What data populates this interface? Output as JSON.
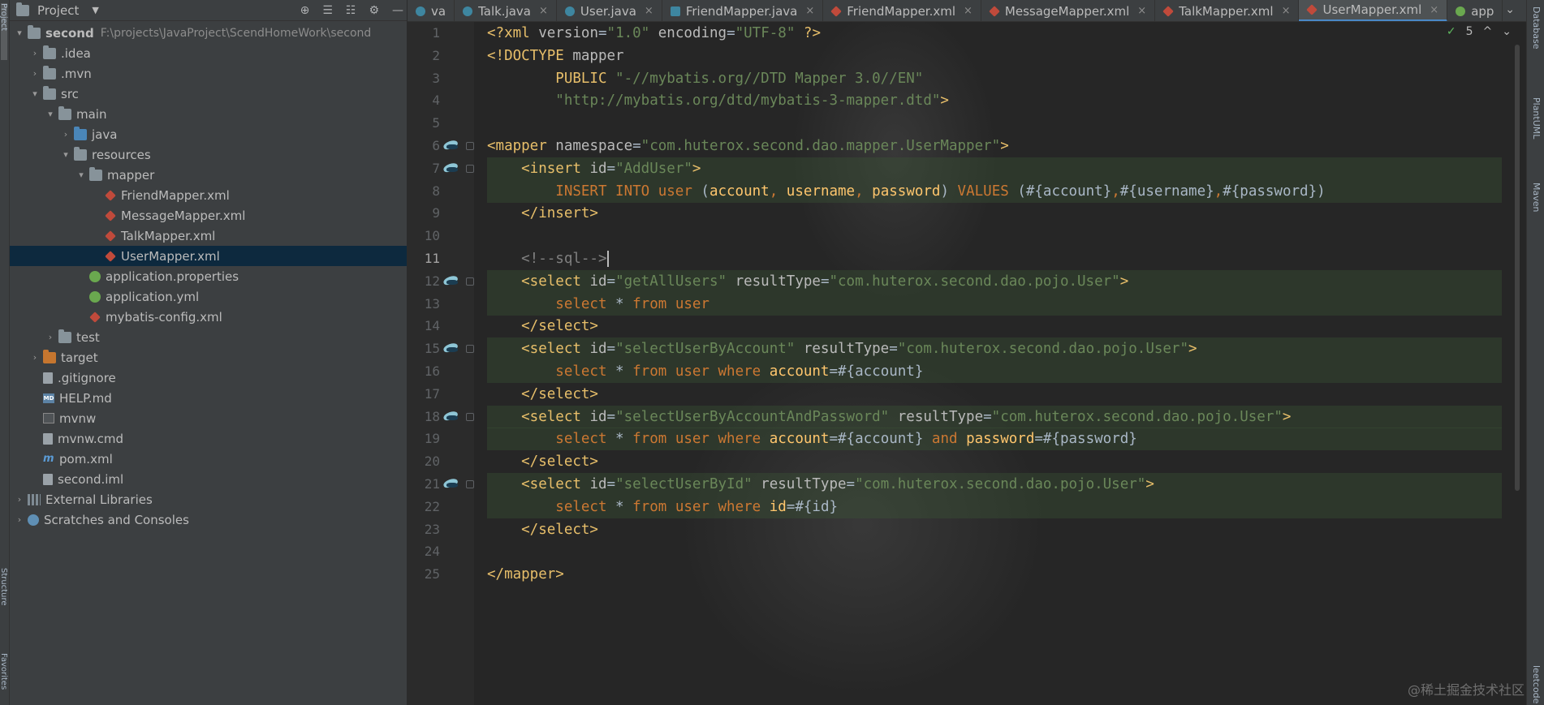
{
  "left_strip": {
    "top_label": "Project",
    "bottom_label": "Structure",
    "fav_label": "Favorites"
  },
  "project_panel": {
    "title": "Project",
    "caret": "▼",
    "tools": [
      "⊕",
      "☰",
      "☷",
      "⚙",
      "—"
    ]
  },
  "tree": [
    {
      "label": "second",
      "path": "F:\\projects\\JavaProject\\ScendHomeWork\\second",
      "indent": 0,
      "arrow": "▾",
      "icon": "folder",
      "bold": true
    },
    {
      "label": ".idea",
      "indent": 1,
      "arrow": "›",
      "icon": "folder"
    },
    {
      "label": ".mvn",
      "indent": 1,
      "arrow": "›",
      "icon": "folder"
    },
    {
      "label": "src",
      "indent": 1,
      "arrow": "▾",
      "icon": "folder"
    },
    {
      "label": "main",
      "indent": 2,
      "arrow": "▾",
      "icon": "folder"
    },
    {
      "label": "java",
      "indent": 3,
      "arrow": "›",
      "icon": "folder-blue"
    },
    {
      "label": "resources",
      "indent": 3,
      "arrow": "▾",
      "icon": "folder-res"
    },
    {
      "label": "mapper",
      "indent": 4,
      "arrow": "▾",
      "icon": "folder"
    },
    {
      "label": "FriendMapper.xml",
      "indent": 5,
      "arrow": "",
      "icon": "xml"
    },
    {
      "label": "MessageMapper.xml",
      "indent": 5,
      "arrow": "",
      "icon": "xml"
    },
    {
      "label": "TalkMapper.xml",
      "indent": 5,
      "arrow": "",
      "icon": "xml"
    },
    {
      "label": "UserMapper.xml",
      "indent": 5,
      "arrow": "",
      "icon": "xml",
      "selected": true
    },
    {
      "label": "application.properties",
      "indent": 4,
      "arrow": "",
      "icon": "spring"
    },
    {
      "label": "application.yml",
      "indent": 4,
      "arrow": "",
      "icon": "spring"
    },
    {
      "label": "mybatis-config.xml",
      "indent": 4,
      "arrow": "",
      "icon": "xml"
    },
    {
      "label": "test",
      "indent": 2,
      "arrow": "›",
      "icon": "folder"
    },
    {
      "label": "target",
      "indent": 1,
      "arrow": "›",
      "icon": "folder-orange"
    },
    {
      "label": ".gitignore",
      "indent": 1,
      "arrow": "",
      "icon": "file"
    },
    {
      "label": "HELP.md",
      "indent": 1,
      "arrow": "",
      "icon": "md"
    },
    {
      "label": "mvnw",
      "indent": 1,
      "arrow": "",
      "icon": "term"
    },
    {
      "label": "mvnw.cmd",
      "indent": 1,
      "arrow": "",
      "icon": "file"
    },
    {
      "label": "pom.xml",
      "indent": 1,
      "arrow": "",
      "icon": "maven"
    },
    {
      "label": "second.iml",
      "indent": 1,
      "arrow": "",
      "icon": "file"
    },
    {
      "label": "External Libraries",
      "indent": 0,
      "arrow": "›",
      "icon": "lib"
    },
    {
      "label": "Scratches and Consoles",
      "indent": 0,
      "arrow": "›",
      "icon": "scratch"
    }
  ],
  "tabs": [
    {
      "label": "va",
      "icon": "c"
    },
    {
      "label": "Talk.java",
      "icon": "c"
    },
    {
      "label": "User.java",
      "icon": "c"
    },
    {
      "label": "FriendMapper.java",
      "icon": "m"
    },
    {
      "label": "FriendMapper.xml",
      "icon": "x"
    },
    {
      "label": "MessageMapper.xml",
      "icon": "x"
    },
    {
      "label": "TalkMapper.xml",
      "icon": "x"
    },
    {
      "label": "UserMapper.xml",
      "icon": "x",
      "active": true
    },
    {
      "label": "app",
      "icon": "s"
    }
  ],
  "tab_overflow": "⌄",
  "inspection": {
    "check": "✓",
    "count": "5",
    "up": "^",
    "down": "⌄"
  },
  "current_line": 11,
  "line_numbers": [
    "1",
    "2",
    "3",
    "4",
    "5",
    "6",
    "7",
    "8",
    "9",
    "10",
    "11",
    "12",
    "13",
    "14",
    "15",
    "16",
    "17",
    "18",
    "19",
    "20",
    "21",
    "22",
    "23",
    "24",
    "25"
  ],
  "gutter_markers": [
    6,
    7,
    12,
    15,
    18,
    21
  ],
  "highlighted_lines": [
    7,
    8,
    12,
    13,
    15,
    16,
    18,
    19,
    21,
    22
  ],
  "code": [
    [
      {
        "t": "<?",
        "c": "tagc"
      },
      {
        "t": "xml ",
        "c": "tagc"
      },
      {
        "t": "version",
        "c": "attr"
      },
      {
        "t": "=",
        "c": "prm"
      },
      {
        "t": "\"1.0\"",
        "c": "str"
      },
      {
        "t": " encoding",
        "c": "attr"
      },
      {
        "t": "=",
        "c": "prm"
      },
      {
        "t": "\"UTF-8\"",
        "c": "str"
      },
      {
        "t": " ?>",
        "c": "tagc"
      }
    ],
    [
      {
        "t": "<!DOCTYPE ",
        "c": "tagc"
      },
      {
        "t": "mapper",
        "c": "attr"
      }
    ],
    [
      {
        "t": "        PUBLIC ",
        "c": "tagc"
      },
      {
        "t": "\"-//mybatis.org//DTD Mapper 3.0//EN\"",
        "c": "str"
      }
    ],
    [
      {
        "t": "        ",
        "c": "prm"
      },
      {
        "t": "\"http://mybatis.org/dtd/mybatis-3-mapper.dtd\"",
        "c": "str"
      },
      {
        "t": ">",
        "c": "tagc"
      }
    ],
    [],
    [
      {
        "t": "<mapper ",
        "c": "tagc"
      },
      {
        "t": "namespace",
        "c": "attr"
      },
      {
        "t": "=",
        "c": "prm"
      },
      {
        "t": "\"com.huterox.second.dao.mapper.UserMapper\"",
        "c": "str"
      },
      {
        "t": ">",
        "c": "tagc"
      }
    ],
    [
      {
        "t": "    <insert ",
        "c": "tagc"
      },
      {
        "t": "id",
        "c": "attr"
      },
      {
        "t": "=",
        "c": "prm"
      },
      {
        "t": "\"AddUser\"",
        "c": "str"
      },
      {
        "t": ">",
        "c": "tagc"
      }
    ],
    [
      {
        "t": "        INSERT INTO ",
        "c": "kw"
      },
      {
        "t": "user ",
        "c": "kw"
      },
      {
        "t": "(",
        "c": "prm"
      },
      {
        "t": "account",
        "c": "fld"
      },
      {
        "t": ", ",
        "c": "kw"
      },
      {
        "t": "username",
        "c": "fld"
      },
      {
        "t": ", ",
        "c": "kw"
      },
      {
        "t": "password",
        "c": "fld"
      },
      {
        "t": ") ",
        "c": "prm"
      },
      {
        "t": "VALUES ",
        "c": "kw"
      },
      {
        "t": "(#{account}",
        "c": "prm"
      },
      {
        "t": ",",
        "c": "kw"
      },
      {
        "t": "#{username}",
        "c": "prm"
      },
      {
        "t": ",",
        "c": "kw"
      },
      {
        "t": "#{password})",
        "c": "prm"
      }
    ],
    [
      {
        "t": "    </insert>",
        "c": "tagc"
      }
    ],
    [],
    [
      {
        "t": "    <!--sql-->",
        "c": "cmt"
      }
    ],
    [
      {
        "t": "    <select ",
        "c": "tagc"
      },
      {
        "t": "id",
        "c": "attr"
      },
      {
        "t": "=",
        "c": "prm"
      },
      {
        "t": "\"getAllUsers\"",
        "c": "str"
      },
      {
        "t": " resultType",
        "c": "attr"
      },
      {
        "t": "=",
        "c": "prm"
      },
      {
        "t": "\"com.huterox.second.dao.pojo.User\"",
        "c": "str"
      },
      {
        "t": ">",
        "c": "tagc"
      }
    ],
    [
      {
        "t": "        select ",
        "c": "kw"
      },
      {
        "t": "* ",
        "c": "prm"
      },
      {
        "t": "from ",
        "c": "kw"
      },
      {
        "t": "user",
        "c": "kw"
      }
    ],
    [
      {
        "t": "    </select>",
        "c": "tagc"
      }
    ],
    [
      {
        "t": "    <select ",
        "c": "tagc"
      },
      {
        "t": "id",
        "c": "attr"
      },
      {
        "t": "=",
        "c": "prm"
      },
      {
        "t": "\"selectUserByAccount\"",
        "c": "str"
      },
      {
        "t": " resultType",
        "c": "attr"
      },
      {
        "t": "=",
        "c": "prm"
      },
      {
        "t": "\"com.huterox.second.dao.pojo.User\"",
        "c": "str"
      },
      {
        "t": ">",
        "c": "tagc"
      }
    ],
    [
      {
        "t": "        select ",
        "c": "kw"
      },
      {
        "t": "* ",
        "c": "prm"
      },
      {
        "t": "from ",
        "c": "kw"
      },
      {
        "t": "user ",
        "c": "kw"
      },
      {
        "t": "where ",
        "c": "kw"
      },
      {
        "t": "account",
        "c": "fld"
      },
      {
        "t": "=#{account}",
        "c": "prm"
      }
    ],
    [
      {
        "t": "    </select>",
        "c": "tagc"
      }
    ],
    [
      {
        "t": "    <select ",
        "c": "tagc"
      },
      {
        "t": "id",
        "c": "attr"
      },
      {
        "t": "=",
        "c": "prm"
      },
      {
        "t": "\"selectUserByAccountAndPassword\"",
        "c": "str"
      },
      {
        "t": " resultType",
        "c": "attr"
      },
      {
        "t": "=",
        "c": "prm"
      },
      {
        "t": "\"com.huterox.second.dao.pojo.User\"",
        "c": "str"
      },
      {
        "t": ">",
        "c": "tagc"
      }
    ],
    [
      {
        "t": "        select ",
        "c": "kw"
      },
      {
        "t": "* ",
        "c": "prm"
      },
      {
        "t": "from ",
        "c": "kw"
      },
      {
        "t": "user ",
        "c": "kw"
      },
      {
        "t": "where ",
        "c": "kw"
      },
      {
        "t": "account",
        "c": "fld"
      },
      {
        "t": "=#{account} ",
        "c": "prm"
      },
      {
        "t": "and ",
        "c": "kw"
      },
      {
        "t": "password",
        "c": "fld"
      },
      {
        "t": "=#{password}",
        "c": "prm"
      }
    ],
    [
      {
        "t": "    </select>",
        "c": "tagc"
      }
    ],
    [
      {
        "t": "    <select ",
        "c": "tagc"
      },
      {
        "t": "id",
        "c": "attr"
      },
      {
        "t": "=",
        "c": "prm"
      },
      {
        "t": "\"selectUserById\"",
        "c": "str"
      },
      {
        "t": " resultType",
        "c": "attr"
      },
      {
        "t": "=",
        "c": "prm"
      },
      {
        "t": "\"com.huterox.second.dao.pojo.User\"",
        "c": "str"
      },
      {
        "t": ">",
        "c": "tagc"
      }
    ],
    [
      {
        "t": "        select ",
        "c": "kw"
      },
      {
        "t": "* ",
        "c": "prm"
      },
      {
        "t": "from ",
        "c": "kw"
      },
      {
        "t": "user ",
        "c": "kw"
      },
      {
        "t": "where ",
        "c": "kw"
      },
      {
        "t": "id",
        "c": "fld"
      },
      {
        "t": "=#{id}",
        "c": "prm"
      }
    ],
    [
      {
        "t": "    </select>",
        "c": "tagc"
      }
    ],
    [],
    [
      {
        "t": "</mapper>",
        "c": "tagc"
      }
    ]
  ],
  "right_strip": [
    "Database",
    "PlantUML",
    "Maven",
    "leetcode"
  ],
  "watermark": "@稀土掘金技术社区"
}
